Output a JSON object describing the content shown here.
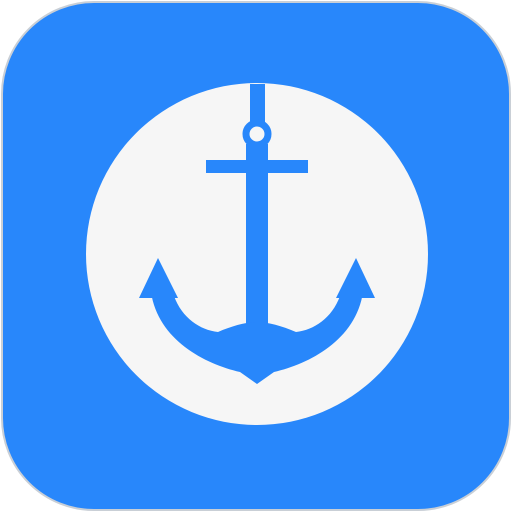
{
  "app_icon": {
    "icon": "anchor-icon",
    "colors": {
      "tile": "#2887fb",
      "tile_border": "#c9cfd6",
      "badge": "#f6f6f6",
      "glyph": "#2887fb"
    }
  }
}
